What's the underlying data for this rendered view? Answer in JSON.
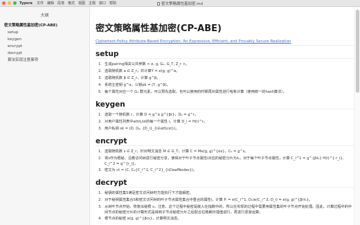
{
  "menubar": {
    "app_name": "Typora",
    "menu_items": [
      "文件",
      "编辑",
      "段落",
      "格式",
      "视图",
      "主题",
      "窗口",
      "帮助"
    ],
    "window_title": "密文策略属性基加密.md"
  },
  "sidebar": {
    "title": "大纲",
    "items": [
      {
        "label": "密文策略属性基加密(CP-ABE)",
        "level": 1
      },
      {
        "label": "setup",
        "level": 2
      },
      {
        "label": "keygen",
        "level": 2
      },
      {
        "label": "encrypt",
        "level": 2
      },
      {
        "label": "decrypt",
        "level": 2
      },
      {
        "label": "算法实现注意事项",
        "level": 2
      }
    ]
  },
  "doc": {
    "title": "密文策略属性基加密(CP-ABE)",
    "link": "Ciphertext-Policy Attribute-Based Encryption: An Expressive, Efficient, and Provably Secure Realization",
    "sections": [
      {
        "heading": "setup",
        "items": [
          "生成pairing相关公共参数 < e, g, G₁, G_T, Z_r >。",
          "选取随机数 a ∈ Z_r，并计算Y = e(g, g)^α。",
          "选取随机数 β ∈ Z_r，计算 g^β。",
          "系统主密钥 g^α，公钥pk = (Y, g^β)。",
          "每个属性对应一个 G₁ 群元素，可以预先选取，也可以使用的时候再对属性进行哈希计算（使用统一的hash算法）。"
        ]
      },
      {
        "heading": "keygen",
        "items": [
          "选取一个随机数 r，计算 D = g^α g^{βr}，D₀ = g^r。",
          "对用户属性列表中attrList的每一个属性 i，计算 D_i = H(i)^r。",
          "用户私钥 sk = (D, D₀, {D_i}_{i∈attList})。"
        ]
      },
      {
        "heading": "encrypt",
        "items": [
          "选取随机数 s ∈ Z_r，针对明文消息 M ∈ G_T，计算 C = Me(g, g)^{αs}，C₀ = g^s。",
          "将s作为根秘，沿着访问树进行秘密分享，使得对于叶子节点属性i对应的秘密分片为λᵢ，对于每个叶子节点属性，计算 C_i^1 = g^{βλᵢ} H(i)^{-r_i}, C_i^2 = g^{r_i}。",
          "密文为 ct = (C, C₀{C_i^1, C_i^2}_{i∈leafNodes})。"
        ]
      },
      {
        "heading": "decrypt",
        "items": [
          "秘钥的属性集S满足密文访问树时方能执行下才能解密。",
          "对于秘钥属性集合S和密文访问树的叶子节点属性集合中重合的属性i，计算 Pᵢ = e(C_i^1, D₀)e(C_i^2, D_i) = e(g, g)^{βrλᵢ}。",
          "从树叶节点开始，恢复出秘根 s，注意，这个过程中秘密是嵌入在指数中的，所以在实现的过程中需要用属性集的叶子节点开始处理。因此，计算过程中的中间节点的秘密分片的计算形式是得到子节点秘密分片之后配合拉格朗日插值进行。再进行逐渐运算。",
          "根节点的秘密 e(g, g)^{βrs}，计算明文消息。"
        ]
      }
    ]
  }
}
